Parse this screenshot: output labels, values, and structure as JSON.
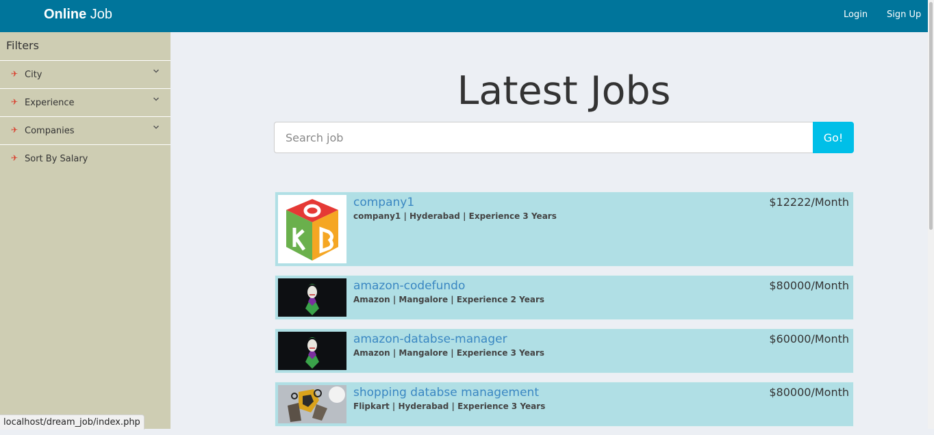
{
  "navbar": {
    "brand_bold": "Online",
    "brand_rest": "Job",
    "login_label": "Login",
    "signup_label": "Sign Up"
  },
  "sidebar": {
    "title": "Filters",
    "items": [
      {
        "label": "City",
        "icon": "plane-icon",
        "expandable": true
      },
      {
        "label": "Experience",
        "icon": "plane-icon",
        "expandable": true
      },
      {
        "label": "Companies",
        "icon": "plane-icon",
        "expandable": true
      },
      {
        "label": "Sort By Salary",
        "icon": "plane-icon",
        "expandable": false
      }
    ]
  },
  "main": {
    "title": "Latest Jobs",
    "search": {
      "placeholder": "Search job",
      "value": "",
      "button_label": "Go!"
    }
  },
  "jobs": [
    {
      "title": "company1",
      "meta": "company1 | Hyderabad | Experience 3 Years",
      "salary": "$12222/Month",
      "logo": "k2b-cube-logo"
    },
    {
      "title": "amazon-codefundo",
      "meta": "Amazon | Mangalore | Experience 2 Years",
      "salary": "$80000/Month",
      "logo": "joker-logo"
    },
    {
      "title": "amazon-databse-manager",
      "meta": "Amazon | Mangalore | Experience 3 Years",
      "salary": "$60000/Month",
      "logo": "joker-logo"
    },
    {
      "title": "shopping databse management",
      "meta": "Flipkart | Hyderabad | Experience 3 Years",
      "salary": "$80000/Month",
      "logo": "robot-logo"
    }
  ],
  "status_bar": {
    "url": "localhost/dream_job/index.php"
  },
  "colors": {
    "navbar": "#00759b",
    "sidebar": "#cecdb3",
    "card": "#b0dfe5",
    "go_button": "#00bfe8",
    "link": "#3a87c2",
    "icon": "#d9402f",
    "background": "#eceff4"
  }
}
